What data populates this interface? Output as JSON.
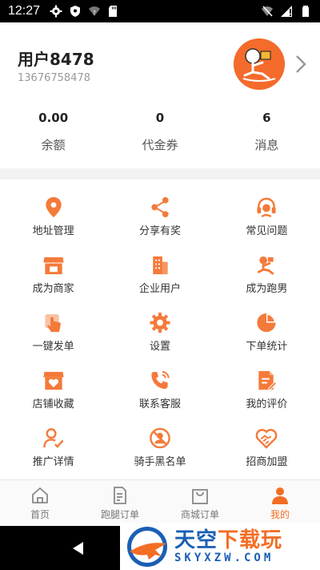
{
  "status_bar": {
    "time": "12:27"
  },
  "user": {
    "name": "用户8478",
    "phone": "13676758478"
  },
  "stats": [
    {
      "value": "0.00",
      "label": "余额"
    },
    {
      "value": "0",
      "label": "代金券"
    },
    {
      "value": "6",
      "label": "消息"
    }
  ],
  "menu": [
    {
      "label": "地址管理",
      "icon": "location-pin-icon"
    },
    {
      "label": "分享有奖",
      "icon": "share-icon"
    },
    {
      "label": "常见问题",
      "icon": "headset-icon"
    },
    {
      "label": "成为商家",
      "icon": "storefront-icon"
    },
    {
      "label": "企业用户",
      "icon": "building-icon"
    },
    {
      "label": "成为跑男",
      "icon": "runner-icon"
    },
    {
      "label": "一键发单",
      "icon": "tap-icon"
    },
    {
      "label": "设置",
      "icon": "gear-icon"
    },
    {
      "label": "下单统计",
      "icon": "pie-chart-icon"
    },
    {
      "label": "店铺收藏",
      "icon": "shop-favorite-icon"
    },
    {
      "label": "联系客服",
      "icon": "phone-call-icon"
    },
    {
      "label": "我的评价",
      "icon": "review-doc-icon"
    },
    {
      "label": "推广详情",
      "icon": "user-check-icon"
    },
    {
      "label": "骑手黑名单",
      "icon": "user-block-icon"
    },
    {
      "label": "招商加盟",
      "icon": "handshake-icon"
    }
  ],
  "tabs": [
    {
      "label": "首页",
      "icon": "home-icon",
      "active": false
    },
    {
      "label": "跑腿订单",
      "icon": "order-icon",
      "active": false
    },
    {
      "label": "商城订单",
      "icon": "shopping-bag-icon",
      "active": false
    },
    {
      "label": "我的",
      "icon": "person-icon",
      "active": true
    }
  ],
  "watermark": {
    "title_blue": "天空",
    "title_orange": "下载玩",
    "sub": "SKYXZW.COM"
  },
  "colors": {
    "accent": "#f36e25",
    "icon": "#f47a3a",
    "watermark_blue": "#1a5fb4"
  }
}
